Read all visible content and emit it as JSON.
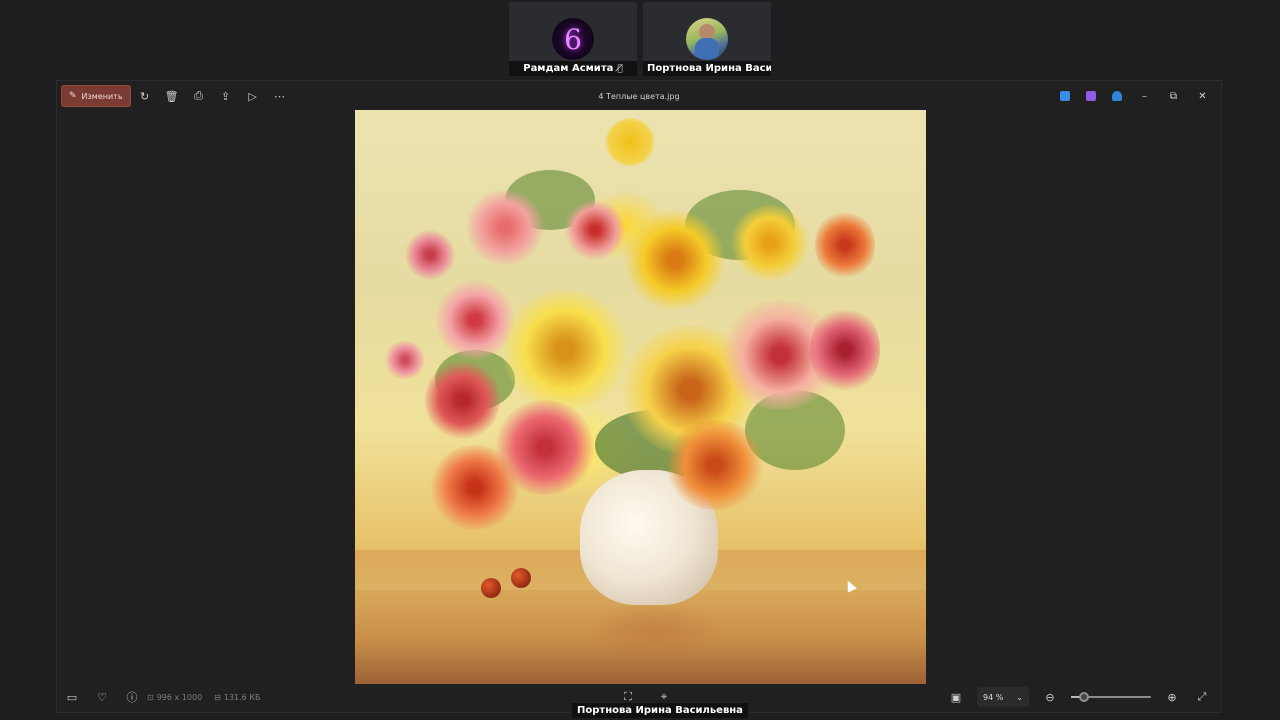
{
  "participants": [
    {
      "name": "Рамдам Асмита",
      "avatar": "6",
      "muted": true
    },
    {
      "name": "Портнова Ирина Васильевн",
      "avatar": "photo",
      "muted": false
    }
  ],
  "window": {
    "title": "4 Теплые цвета.jpg",
    "edit_label": "Изменить",
    "toolbar_icons": [
      "rotate-icon",
      "delete-icon",
      "print-icon",
      "share-icon",
      "slideshow-icon",
      "more-icon"
    ],
    "app_icons": [
      {
        "name": "designer-app-icon",
        "color": "#3a8ee6"
      },
      {
        "name": "clipchamp-app-icon",
        "color": "#8f5ce8"
      },
      {
        "name": "onedrive-app-icon",
        "color": "#2f86d8"
      }
    ],
    "controls": {
      "minimize": "–",
      "restore": "⧉",
      "close": "✕"
    }
  },
  "status": {
    "dimensions": "996 x 1000",
    "file_size": "131.6 КБ",
    "zoom": "94 %",
    "zoom_level": 0.12
  },
  "caption": "Портнова Ирина Васильевна"
}
